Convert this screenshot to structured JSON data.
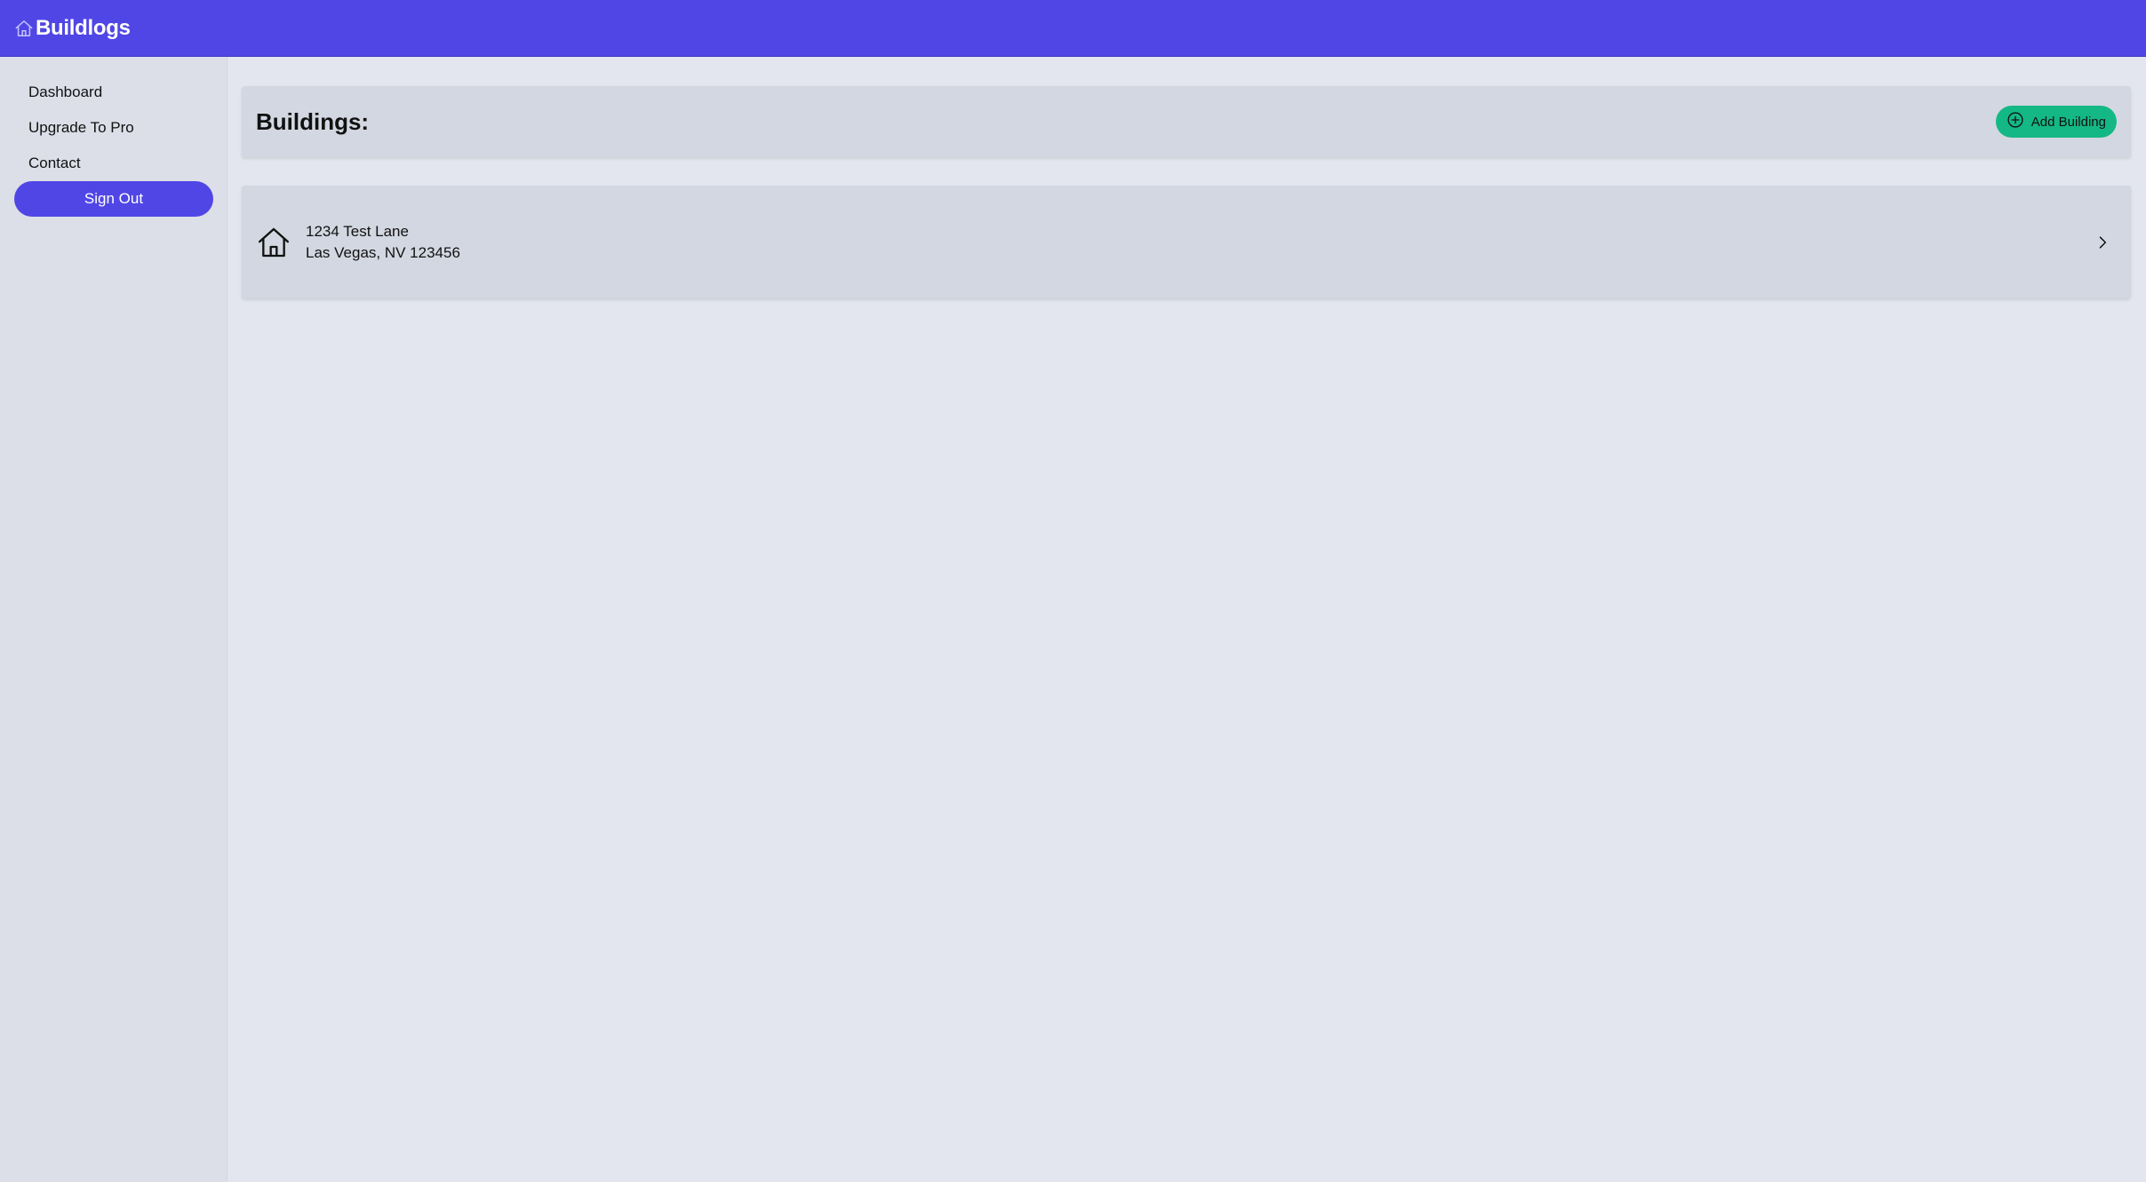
{
  "app": {
    "name": "Buildlogs",
    "logo_icon": "home-icon",
    "brand_color": "#5046e5"
  },
  "sidebar": {
    "items": [
      {
        "label": "Dashboard"
      },
      {
        "label": "Upgrade To Pro"
      },
      {
        "label": "Contact"
      }
    ],
    "sign_out_label": "Sign Out"
  },
  "main": {
    "title": "Buildings:",
    "add_button": {
      "label": "Add Building",
      "icon": "plus-circle-icon",
      "color": "#14b884"
    },
    "buildings": [
      {
        "street": "1234 Test Lane",
        "city_line": "Las Vegas, NV 123456",
        "icon": "home-icon"
      }
    ]
  }
}
